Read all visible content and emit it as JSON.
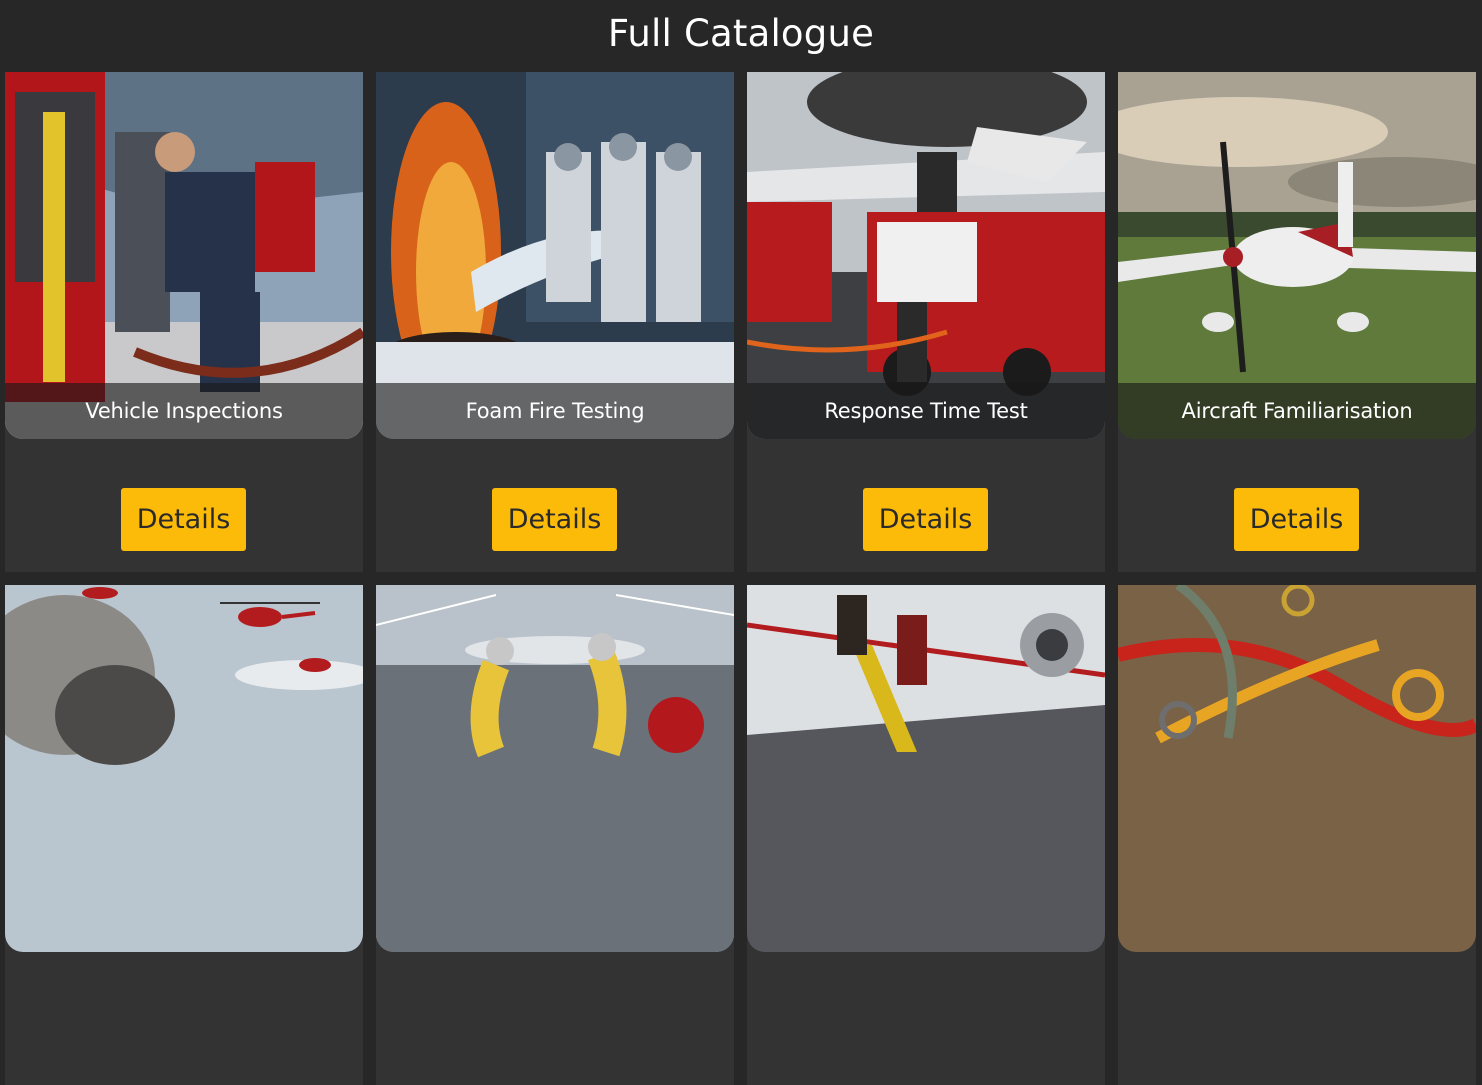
{
  "page": {
    "title": "Full Catalogue"
  },
  "cards": [
    {
      "title": "Vehicle Inspections",
      "button": "Details",
      "image": "technician-inspecting-fire-truck"
    },
    {
      "title": "Foam Fire Testing",
      "button": "Details",
      "image": "foam-suppressing-fire"
    },
    {
      "title": "Response Time Test",
      "button": "Details",
      "image": "firefighters-at-aircraft-fire"
    },
    {
      "title": "Aircraft Familiarisation",
      "button": "Details",
      "image": "light-aircraft-on-grass"
    },
    {
      "title": "",
      "button": "",
      "image": "helicopters-over-smoke"
    },
    {
      "title": "",
      "button": "",
      "image": "hose-equipment-diagram"
    },
    {
      "title": "",
      "button": "",
      "image": "firefighters-evacuating-aircraft"
    },
    {
      "title": "",
      "button": "",
      "image": "knotted-rescue-ropes"
    }
  ],
  "colors": {
    "background": "#272727",
    "card": "#333333",
    "accent": "#fcbb09"
  }
}
